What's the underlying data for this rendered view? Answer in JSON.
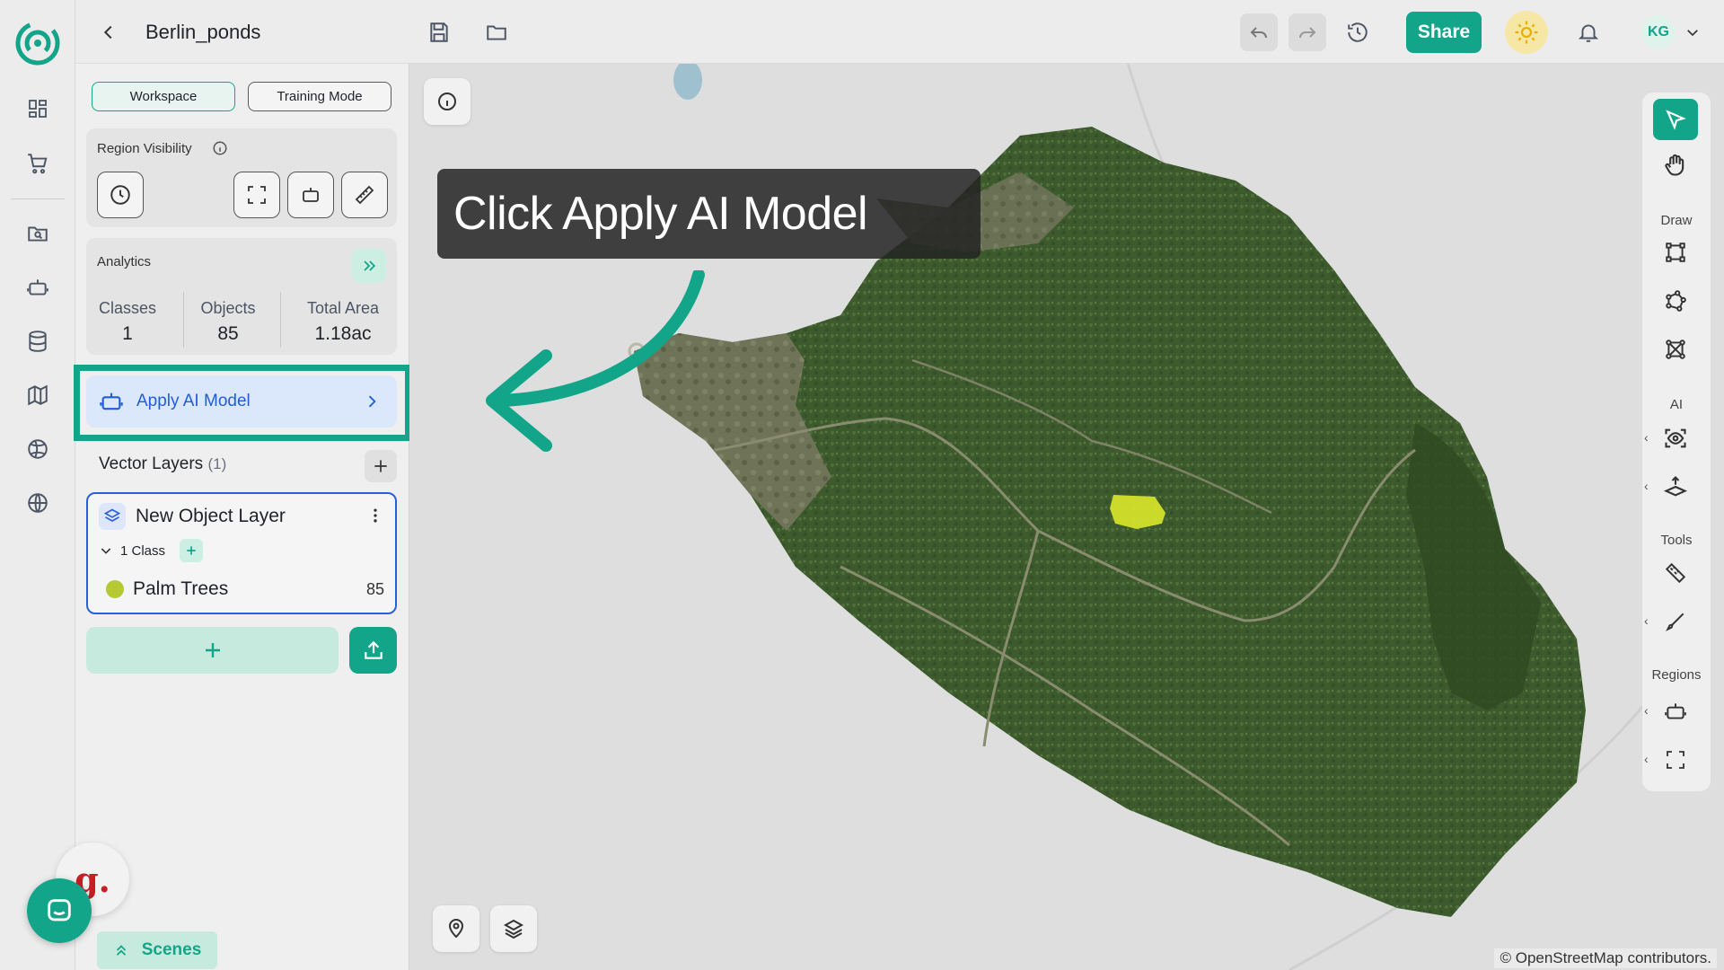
{
  "app": {
    "project_title": "Berlin_ponds",
    "share_label": "Share",
    "user_initials": "KG"
  },
  "panel": {
    "tabs": [
      {
        "label": "Workspace",
        "active": true
      },
      {
        "label": "Training Mode",
        "active": false
      }
    ],
    "region_visibility": {
      "title": "Region Visibility"
    },
    "analytics": {
      "title": "Analytics",
      "stats": [
        {
          "label": "Classes",
          "value": "1"
        },
        {
          "label": "Objects",
          "value": "85"
        },
        {
          "label": "Total Area",
          "value": "1.18ac"
        }
      ]
    },
    "apply_ai_model_label": "Apply AI Model",
    "vector_layers": {
      "title": "Vector Layers",
      "count": "(1)",
      "layers": [
        {
          "name": "New Object Layer",
          "class_count_label": "1 Class",
          "classes": [
            {
              "name": "Palm Trees",
              "count": "85",
              "color": "#b5c934"
            }
          ]
        }
      ]
    },
    "scenes_label": "Scenes"
  },
  "map": {
    "callout_text": "Click Apply AI Model",
    "attribution": "© OpenStreetMap contributors."
  },
  "right_toolbar": {
    "sections": [
      "Draw",
      "AI",
      "Tools",
      "Regions"
    ]
  },
  "colors": {
    "accent": "#13a589",
    "apply_blue": "#1f5ed6",
    "layer_border": "#2b5fd9"
  },
  "icons": {
    "logo": "app-logo-icon",
    "chat": "chat-icon",
    "g_brand": "g."
  }
}
